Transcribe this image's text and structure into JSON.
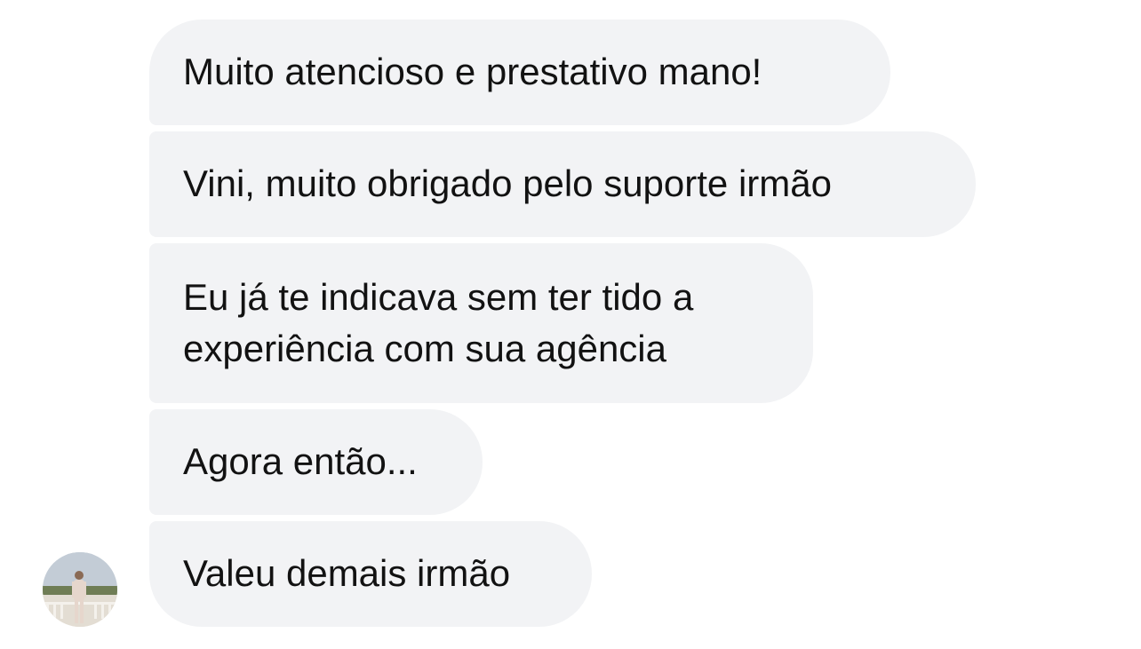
{
  "conversation": {
    "messages": [
      {
        "text": "Muito atencioso e prestativo mano!"
      },
      {
        "text": "Vini, muito obrigado pelo suporte irmão"
      },
      {
        "text": "Eu já te indicava sem ter tido a experiência com sua agência"
      },
      {
        "text": "Agora então..."
      },
      {
        "text": "Valeu demais irmão"
      }
    ],
    "sender_avatar_icon": "person-avatar-photo",
    "bubble_color": "#f2f3f5",
    "text_color": "#121212"
  }
}
